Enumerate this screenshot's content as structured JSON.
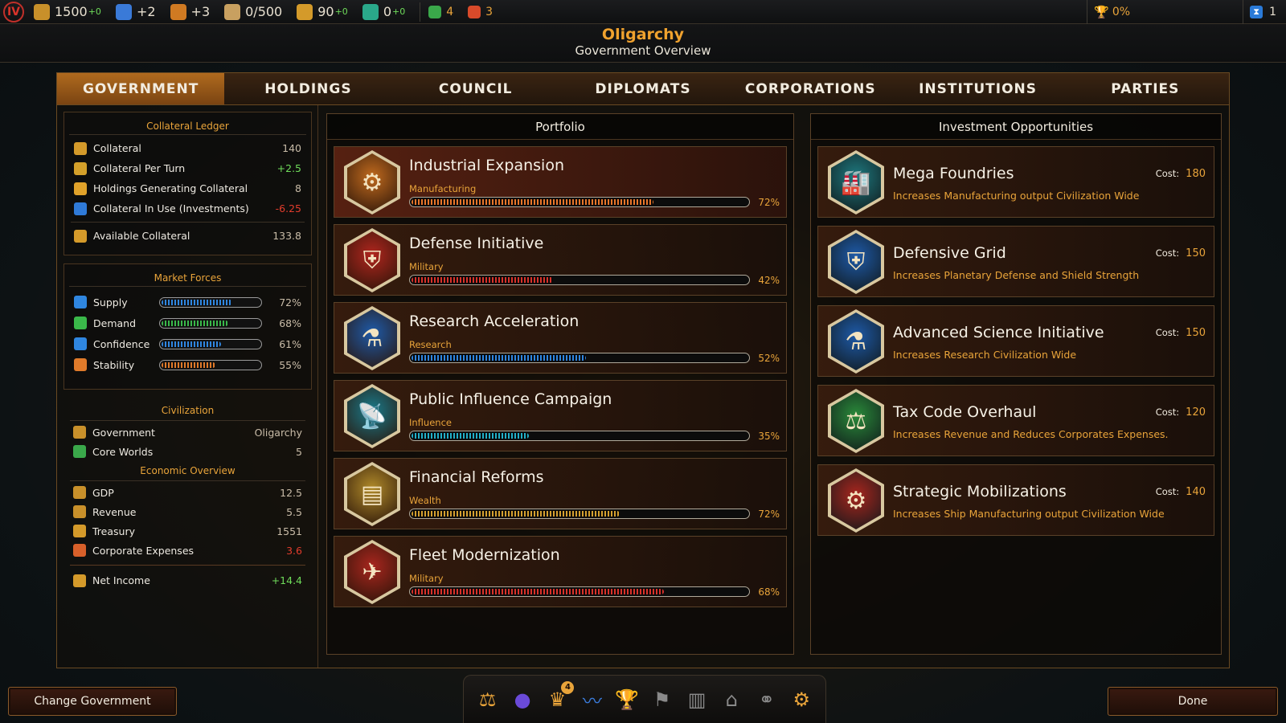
{
  "topbar": {
    "era": "IV",
    "resources": [
      {
        "icon": "coin-stack-icon",
        "value": "1500",
        "delta": "+0",
        "color": "#c8902a"
      },
      {
        "icon": "science-flask-icon",
        "value": "+2",
        "color": "#3a7ad8"
      },
      {
        "icon": "hammer-icon",
        "value": "+3",
        "color": "#d07a22"
      },
      {
        "icon": "crate-icon",
        "value": "0/500",
        "color": "#c8a060"
      },
      {
        "icon": "scales-icon",
        "value": "90",
        "delta": "+0",
        "color": "#d49a2a"
      },
      {
        "icon": "building-icon",
        "value": "0",
        "delta": "+0",
        "color": "#2aa88a"
      }
    ],
    "small": [
      {
        "icon": "happiness-icon",
        "value": "4",
        "color": "#3aa84a"
      },
      {
        "icon": "unrest-icon",
        "value": "3",
        "color": "#d84a2a"
      }
    ],
    "victory": "0%",
    "turn": "1"
  },
  "header": {
    "title": "Oligarchy",
    "subtitle": "Government Overview"
  },
  "tabs": [
    "GOVERNMENT",
    "HOLDINGS",
    "COUNCIL",
    "DIPLOMATS",
    "CORPORATIONS",
    "INSTITUTIONS",
    "PARTIES"
  ],
  "ledger": {
    "title": "Collateral Ledger",
    "rows": [
      {
        "label": "Collateral",
        "value": "140"
      },
      {
        "label": "Collateral Per Turn",
        "value": "+2.5"
      },
      {
        "label": "Holdings Generating Collateral",
        "value": "8"
      },
      {
        "label": "Collateral In Use (Investments)",
        "value": "-6.25"
      }
    ],
    "available": {
      "label": "Available Collateral",
      "value": "133.8"
    }
  },
  "market": {
    "title": "Market Forces",
    "rows": [
      {
        "label": "Supply",
        "value": "72%",
        "level": 0.72,
        "color": "#2f86e0"
      },
      {
        "label": "Demand",
        "value": "68%",
        "level": 0.68,
        "color": "#3ab84a"
      },
      {
        "label": "Confidence",
        "value": "61%",
        "level": 0.61,
        "color": "#2f86e0"
      },
      {
        "label": "Stability",
        "value": "55%",
        "level": 0.55,
        "color": "#e07a2a"
      }
    ]
  },
  "civ": {
    "title": "Civilization",
    "rows": [
      {
        "label": "Government",
        "value": "Oligarchy"
      },
      {
        "label": "Core Worlds",
        "value": "5"
      }
    ]
  },
  "econ": {
    "title": "Economic Overview",
    "rows": [
      {
        "label": "GDP",
        "value": "12.5"
      },
      {
        "label": "Revenue",
        "value": "5.5"
      },
      {
        "label": "Treasury",
        "value": "1551"
      },
      {
        "label": "Corporate Expenses",
        "value": "3.6"
      }
    ],
    "net": {
      "label": "Net Income",
      "value": "+14.4"
    }
  },
  "portfolio": {
    "title": "Portfolio",
    "items": [
      {
        "name": "Industrial Expansion",
        "category": "Manufacturing",
        "pct": "72%",
        "level": 0.72,
        "color": "#e8762a",
        "icon": "gear-icon",
        "glyph": "⚙",
        "hex": "#c06a1e"
      },
      {
        "name": "Defense Initiative",
        "category": "Military",
        "pct": "42%",
        "level": 0.42,
        "color": "#d8322a",
        "icon": "shield-icon",
        "glyph": "⛨",
        "hex": "#b0261e"
      },
      {
        "name": "Research Acceleration",
        "category": "Research",
        "pct": "52%",
        "level": 0.52,
        "color": "#2f86e0",
        "icon": "flask-icon",
        "glyph": "⚗",
        "hex": "#1e5aa8"
      },
      {
        "name": "Public Influence Campaign",
        "category": "Influence",
        "pct": "35%",
        "level": 0.35,
        "color": "#22b0c8",
        "icon": "satellite-dish-icon",
        "glyph": "📡",
        "hex": "#1a7a8a"
      },
      {
        "name": "Financial Reforms",
        "category": "Wealth",
        "pct": "72%",
        "level": 0.62,
        "color": "#d4a030",
        "icon": "gold-bars-icon",
        "glyph": "▤",
        "hex": "#b08a2a"
      },
      {
        "name": "Fleet Modernization",
        "category": "Military",
        "pct": "68%",
        "level": 0.75,
        "color": "#d8322a",
        "icon": "starship-icon",
        "glyph": "✈",
        "hex": "#a8261e"
      }
    ]
  },
  "investments": {
    "title": "Investment Opportunities",
    "cost_label": "Cost:",
    "items": [
      {
        "name": "Mega Foundries",
        "desc": "Increases Manufacturing output Civilization Wide",
        "cost": "180",
        "icon": "factory-icon",
        "glyph": "🏭",
        "hex": "#1e7a80"
      },
      {
        "name": "Defensive Grid",
        "desc": "Increases Planetary Defense and Shield Strength",
        "cost": "150",
        "icon": "shield-icon",
        "glyph": "⛨",
        "hex": "#1e5aa8"
      },
      {
        "name": "Advanced Science Initiative",
        "desc": "Increases Research Civilization Wide",
        "cost": "150",
        "icon": "lab-flasks-icon",
        "glyph": "⚗",
        "hex": "#1e5aa8"
      },
      {
        "name": "Tax Code Overhaul",
        "desc": "Increases Revenue and Reduces Corporates Expenses.",
        "cost": "120",
        "icon": "scales-icon",
        "glyph": "⚖",
        "hex": "#2a8a3a"
      },
      {
        "name": "Strategic Mobilizations",
        "desc": "Increases Ship Manufacturing output Civilization Wide",
        "cost": "140",
        "icon": "ship-gear-icon",
        "glyph": "⚙",
        "hex": "#a8261e"
      }
    ]
  },
  "buttons": {
    "change_gov": "Change Government",
    "done": "Done"
  },
  "dock": [
    {
      "icon": "scales-icon",
      "glyph": "⚖",
      "color": "#e9a43a"
    },
    {
      "icon": "planet-icon",
      "glyph": "●",
      "color": "#6a4ad8"
    },
    {
      "icon": "crown-icon",
      "glyph": "♛",
      "color": "#e9a43a",
      "badge": "4"
    },
    {
      "icon": "trend-chart-icon",
      "glyph": "〰",
      "color": "#3a7ad8"
    },
    {
      "icon": "trophy-icon",
      "glyph": "🏆",
      "color": "#8a8a8a"
    },
    {
      "icon": "flag-icon",
      "glyph": "⚑",
      "color": "#8a8a8a"
    },
    {
      "icon": "pillar-icon",
      "glyph": "▥",
      "color": "#8a8a8a"
    },
    {
      "icon": "temple-icon",
      "glyph": "⌂",
      "color": "#8a8a8a"
    },
    {
      "icon": "handshake-icon",
      "glyph": "⚭",
      "color": "#8a8a8a"
    },
    {
      "icon": "government-gear-icon",
      "glyph": "⚙",
      "color": "#e9a43a"
    }
  ]
}
